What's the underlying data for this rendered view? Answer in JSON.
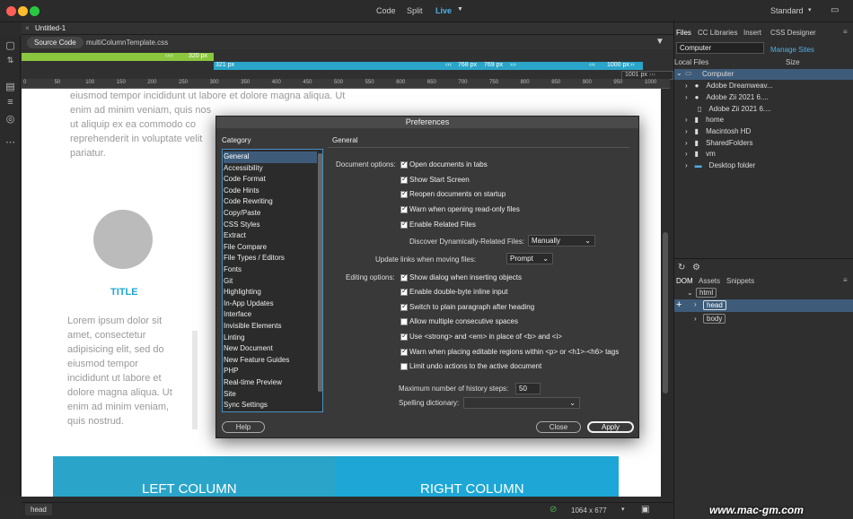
{
  "titlebar": {
    "modes": [
      "Code",
      "Split",
      "Live"
    ],
    "workspace": "Standard"
  },
  "document": {
    "tab": "Untitled-1",
    "source_label": "Source Code",
    "related_file": "multiColumnTemplate.css"
  },
  "media_queries": {
    "q1": "320 px",
    "q2": "321 px",
    "q3": "768 px",
    "q4": "769 px",
    "q5": "1000 px",
    "q6": "1001 px"
  },
  "ruler_labels": [
    "0",
    "50",
    "100",
    "150",
    "200",
    "250",
    "300",
    "350",
    "400",
    "450",
    "500",
    "550",
    "600",
    "650",
    "700",
    "750",
    "800",
    "850",
    "900",
    "950",
    "1000"
  ],
  "canvas": {
    "top_text": [
      "eiusmod tempor incididunt ut labore et dolore magna aliqua. Ut",
      "enim ad minim veniam, quis nos",
      "ut aliquip ex ea commodo co",
      "reprehenderit in voluptate velit",
      "pariatur."
    ],
    "title": "TITLE",
    "col_text": [
      "Lorem ipsum dolor sit",
      "amet, consectetur",
      "adipisicing elit, sed do",
      "eiusmod tempor",
      "incididunt ut labore et",
      "dolore magna aliqua. Ut",
      "enim ad minim veniam,",
      "quis nostrud."
    ],
    "left_column": "LEFT COLUMN",
    "right_column": "RIGHT COLUMN"
  },
  "status": {
    "tag": "head",
    "size": "1064 x 677"
  },
  "right_panel": {
    "tabs": [
      "Files",
      "CC Libraries",
      "Insert",
      "CSS Designer"
    ],
    "site_select": "Computer",
    "manage_sites": "Manage Sites",
    "local_files": "Local Files",
    "size_col": "Size",
    "files": [
      "Computer",
      "Adobe Dreamweav...",
      "Adobe Zii 2021 6....",
      "Adobe Zii 2021 6....",
      "home",
      "Macintosh HD",
      "SharedFolders",
      "vm",
      "Desktop folder"
    ],
    "dom_tabs": [
      "DOM",
      "Assets",
      "Snippets"
    ],
    "dom_nodes": [
      "html",
      "head",
      "body"
    ]
  },
  "dialog": {
    "title": "Preferences",
    "category_label": "Category",
    "section": "General",
    "categories": [
      "General",
      "Accessibility",
      "Code Format",
      "Code Hints",
      "Code Rewriting",
      "Copy/Paste",
      "CSS Styles",
      "Extract",
      "File Compare",
      "File Types / Editors",
      "Fonts",
      "Git",
      "Highlighting",
      "In-App Updates",
      "Interface",
      "Invisible Elements",
      "Linting",
      "New Document",
      "New Feature Guides",
      "PHP",
      "Real-time Preview",
      "Site",
      "Sync Settings"
    ],
    "document_options_label": "Document options:",
    "document_options": [
      {
        "label": "Open documents in tabs",
        "checked": true
      },
      {
        "label": "Show Start Screen",
        "checked": true
      },
      {
        "label": "Reopen documents on startup",
        "checked": true
      },
      {
        "label": "Warn when opening read-only files",
        "checked": true
      },
      {
        "label": "Enable Related Files",
        "checked": true
      }
    ],
    "discover_label": "Discover Dynamically-Related Files:",
    "discover_value": "Manually",
    "update_links_label": "Update links when moving files:",
    "update_links_value": "Prompt",
    "editing_options_label": "Editing options:",
    "editing_options": [
      {
        "label": "Show dialog when inserting objects",
        "checked": true
      },
      {
        "label": "Enable double-byte inline input",
        "checked": true
      },
      {
        "label": "Switch to plain paragraph after heading",
        "checked": true
      },
      {
        "label": "Allow multiple consecutive spaces",
        "checked": false
      },
      {
        "label": "Use <strong> and <em> in place of <b> and <i>",
        "checked": true
      },
      {
        "label": "Warn when placing editable regions within <p> or <h1>-<h6> tags",
        "checked": true
      },
      {
        "label": "Limit undo actions to the active document",
        "checked": false
      }
    ],
    "history_label": "Maximum number of history steps:",
    "history_value": "50",
    "spelling_label": "Spelling dictionary:",
    "spelling_value": "",
    "help": "Help",
    "close": "Close",
    "apply": "Apply"
  },
  "watermark": "www.mac-gm.com",
  "colors": {
    "accent": "#1ea7d6",
    "mq_green": "#8cc63f",
    "mq_blue": "#2aa5c9",
    "selection": "#3e5c7a"
  }
}
